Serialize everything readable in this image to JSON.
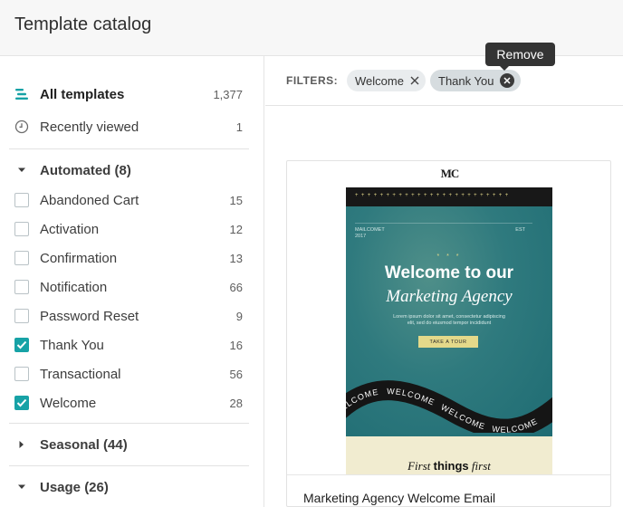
{
  "header": {
    "title": "Template catalog"
  },
  "sidebar": {
    "all_templates": {
      "label": "All templates",
      "count": "1,377"
    },
    "recently_viewed": {
      "label": "Recently viewed",
      "count": "1"
    },
    "automated": {
      "label": "Automated (8)",
      "expanded": true,
      "items": [
        {
          "label": "Abandoned Cart",
          "count": "15",
          "checked": false
        },
        {
          "label": "Activation",
          "count": "12",
          "checked": false
        },
        {
          "label": "Confirmation",
          "count": "13",
          "checked": false
        },
        {
          "label": "Notification",
          "count": "66",
          "checked": false
        },
        {
          "label": "Password Reset",
          "count": "9",
          "checked": false
        },
        {
          "label": "Thank You",
          "count": "16",
          "checked": true
        },
        {
          "label": "Transactional",
          "count": "56",
          "checked": false
        },
        {
          "label": "Welcome",
          "count": "28",
          "checked": true
        }
      ]
    },
    "seasonal": {
      "label": "Seasonal (44)",
      "expanded": false
    },
    "usage": {
      "label": "Usage (26)",
      "expanded": true
    }
  },
  "filters": {
    "label": "FILTERS:",
    "chips": [
      {
        "label": "Welcome",
        "icon": "close-icon"
      },
      {
        "label": "Thank You",
        "icon": "close-circle-icon"
      }
    ],
    "tooltip": "Remove"
  },
  "card": {
    "title": "Marketing Agency Welcome Email",
    "preview": {
      "logo": "MC",
      "meta_left": "MAILCOMET\n2017",
      "meta_right": "EST",
      "stars": "* * *",
      "headline_1": "Welcome to our",
      "headline_2": "Marketing Agency",
      "body": "Lorem ipsum dolor sit amet, consectetur adipiscing elit, sed do eiusmod tempor incididunt",
      "button": "TAKE A TOUR",
      "ribbon_word": "WELCOME",
      "footer_pre": "First",
      "footer_bold": "things",
      "footer_post": "first"
    }
  },
  "colors": {
    "accent": "#17a2a6",
    "tooltip_bg": "#343434",
    "chip_bg": "#e9ecee"
  }
}
